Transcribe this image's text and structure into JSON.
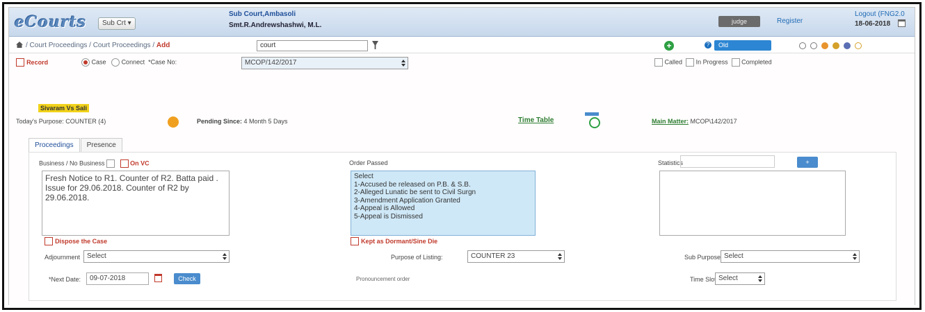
{
  "header": {
    "logo": "eCourts",
    "subcourt_button": "Sub Crt ▾",
    "court_name": "Sub Court,Ambasoli",
    "judge_name": "Smt.R.Andrewshashwi, M.L.",
    "user_button": "judge",
    "register_link": "Register",
    "logout_link": "Logout (FNG2.0",
    "date": "18-06-2018"
  },
  "breadcrumb": {
    "path": "/ Court Proceedings / Court Proceedings / ",
    "current": "Add",
    "search_value": "court",
    "blue_button": "Old"
  },
  "status_dots": [
    "#ffffff",
    "#ffffff",
    "#e8942e",
    "#d4a12a",
    "#5b6fb5",
    "#ffffff"
  ],
  "status_dot_borders": [
    "#777",
    "#777",
    "#e8942e",
    "#d4a12a",
    "#5b6fb5",
    "#d4a12a"
  ],
  "form": {
    "record_label": "Record",
    "case_label": "Case",
    "connect_label": "Connect",
    "case_no_label": "*Case No:",
    "case_no_value": "MCOP/142/2017",
    "called_label": "Called",
    "in_progress_label": "In Progress",
    "completed_label": "Completed",
    "case_title": "Sivaram Vs Sali",
    "todays_purpose_label": "Today's Purpose:",
    "todays_purpose_value": "COUNTER (4)",
    "pending_since_label": "Pending Since:",
    "pending_since_value": "4 Month 5 Days",
    "time_table_link": "Time Table",
    "main_matter_link": "Main Matter:",
    "main_matter_value": "MCOP\\142/2017"
  },
  "tabs": [
    "Proceedings",
    "Presence"
  ],
  "proceedings": {
    "business_label": "Business / No Business",
    "on_vc_label": "On VC",
    "business_text": "Fresh Notice to R1. Counter of R2. Batta paid . Issue for 29.06.2018. Counter of R2 by 29.06.2018.",
    "order_passed_label": "Order Passed",
    "order_options": [
      "Select",
      "1-Accused be released on P.B. & S.B.",
      "2-Alleged Lunatic be sent to Civil Surgn",
      "3-Amendment Application Granted",
      "4-Appeal is Allowed",
      "5-Appeal is Dismissed"
    ],
    "statistics_label": "Statistics",
    "plus_button": "+",
    "dispose_label": "Dispose the Case",
    "dormant_label": "Kept as Dormant/Sine Die",
    "adjournment_label": "Adjournment",
    "adjournment_value": "Select",
    "purpose_listing_label": "Purpose of Listing:",
    "purpose_listing_value": "COUNTER 23",
    "sub_purpose_label": "Sub Purpose:",
    "sub_purpose_value": "Select",
    "next_date_label": "*Next Date:",
    "next_date_value": "09-07-2018",
    "check_button": "Check",
    "judgement_label": "Pronouncement order",
    "time_slot_label": "Time Slot:",
    "time_slot_value": "Select"
  }
}
